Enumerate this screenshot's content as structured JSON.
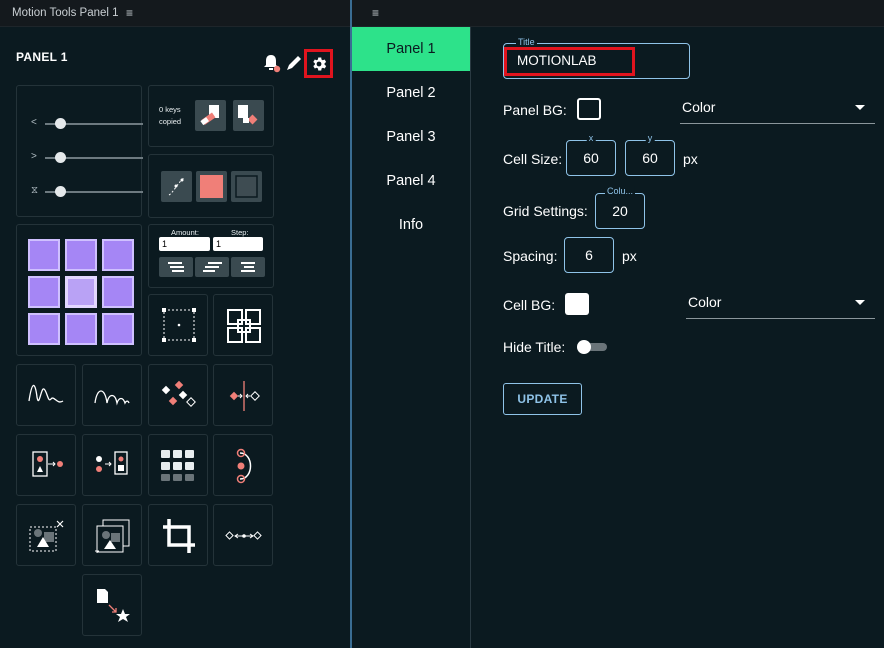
{
  "left_tab": {
    "title": "Motion Tools Panel 1",
    "menu_glyph": "≡"
  },
  "right_tab": {
    "menu_glyph": "≡"
  },
  "panel": {
    "title": "PANEL 1"
  },
  "keys_cell": {
    "line1": "0 keys",
    "line2": "copied"
  },
  "step_cell": {
    "amount_label": "Amount:",
    "step_label": "Step:",
    "amount_value": "1",
    "step_value": "1"
  },
  "nav": {
    "items": [
      {
        "label": "Panel 1",
        "active": true
      },
      {
        "label": "Panel 2",
        "active": false
      },
      {
        "label": "Panel 3",
        "active": false
      },
      {
        "label": "Panel 4",
        "active": false
      },
      {
        "label": "Info",
        "active": false
      }
    ]
  },
  "form": {
    "title_label": "Title",
    "title_value": "MOTIONLAB",
    "panel_bg_label": "Panel BG:",
    "panel_bg_select": "Color",
    "cell_size_label": "Cell Size:",
    "cell_x_label": "x",
    "cell_x_value": "60",
    "cell_y_label": "y",
    "cell_y_value": "60",
    "cell_unit": "px",
    "grid_settings_label": "Grid Settings:",
    "columns_label": "Colu...",
    "columns_value": "20",
    "spacing_label": "Spacing:",
    "spacing_value": "6",
    "spacing_unit": "px",
    "cell_bg_label": "Cell BG:",
    "cell_bg_select": "Color",
    "hide_title_label": "Hide Title:",
    "update_label": "UPDATE"
  },
  "colors": {
    "accent_green": "#2de28a",
    "accent_blue": "#8fc3e8",
    "highlight_red": "#e0141e",
    "purple_cell": "#a586f5",
    "salmon": "#f07f78"
  }
}
